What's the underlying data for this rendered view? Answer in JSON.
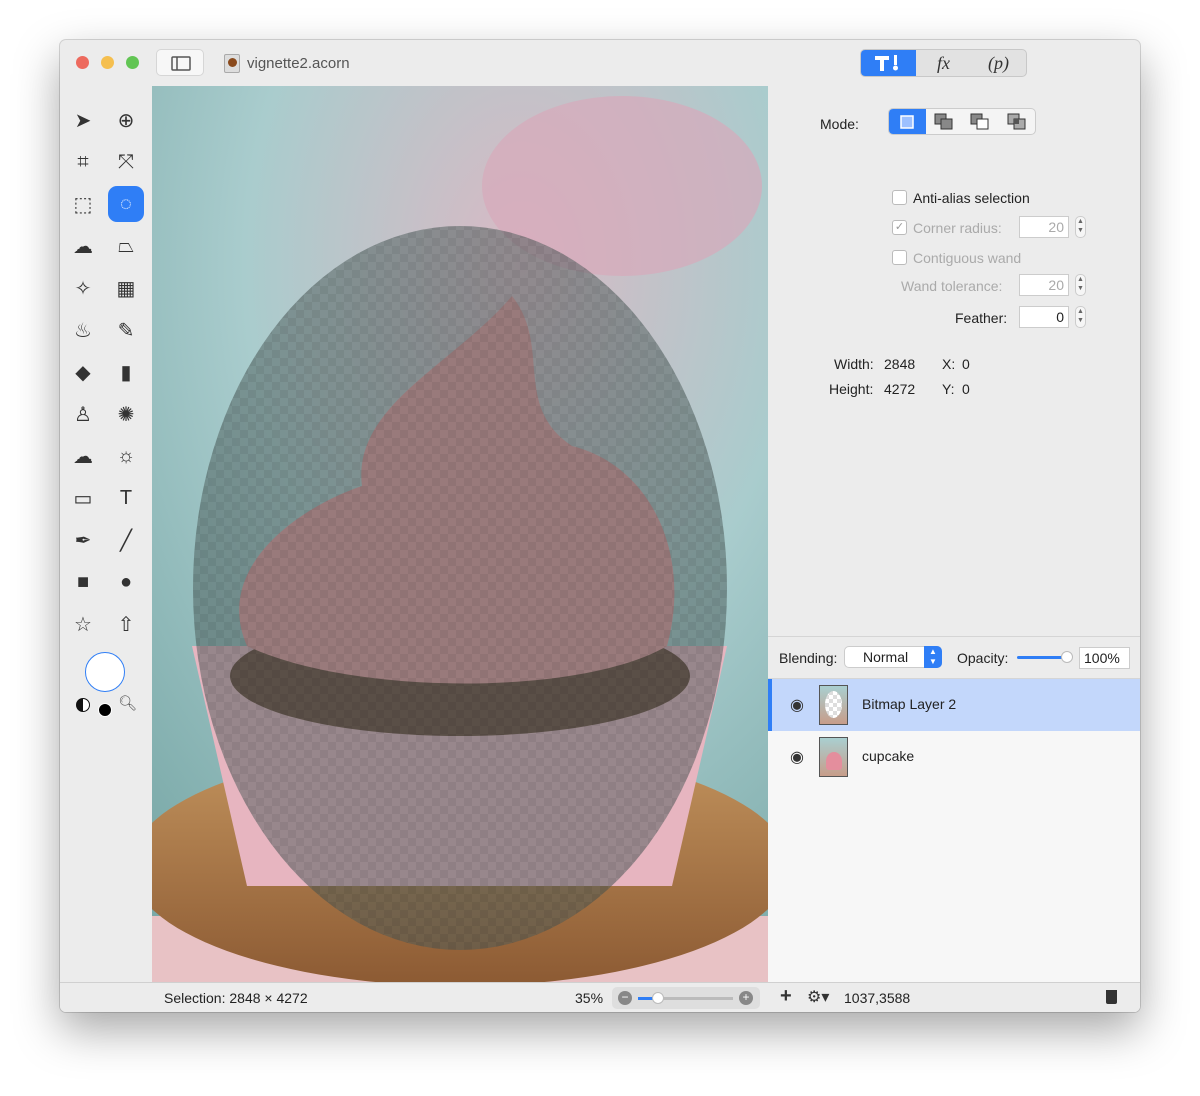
{
  "window": {
    "title": "vignette2.acorn",
    "colors": {
      "close": "#ed6a5e",
      "minimize": "#f5bf4f",
      "zoom": "#62c554",
      "accent": "#2f7ef6"
    }
  },
  "inspector_tabs": [
    {
      "label": "tools-icon",
      "active": true
    },
    {
      "label": "fx"
    },
    {
      "label": "(p)"
    }
  ],
  "tools": [
    "select-arrow",
    "zoom",
    "crop",
    "transform",
    "rect-marquee",
    "ellipse-marquee",
    "lasso",
    "polygon-lasso",
    "magic-wand",
    "color-wand",
    "brush",
    "pencil",
    "eraser",
    "smudge-bucket",
    "clone-stamp",
    "splatter",
    "burn-cloud",
    "dodge-sun",
    "gradient",
    "text",
    "pen",
    "line",
    "rectangle",
    "oval",
    "star",
    "arrow"
  ],
  "active_tool": "ellipse-marquee",
  "selection_options": {
    "mode_label": "Mode:",
    "modes": [
      "replace",
      "add",
      "subtract",
      "intersect"
    ],
    "active_mode": "replace",
    "anti_alias_label": "Anti-alias selection",
    "anti_alias": false,
    "corner_radius_label": "Corner radius:",
    "corner_radius": "20",
    "corner_radius_checked": true,
    "contiguous_label": "Contiguous wand",
    "contiguous": false,
    "wand_tolerance_label": "Wand tolerance:",
    "wand_tolerance": "20",
    "feather_label": "Feather:",
    "feather": "0",
    "width_label": "Width:",
    "width": "2848",
    "height_label": "Height:",
    "height": "4272",
    "x_label": "X:",
    "x": "0",
    "y_label": "Y:",
    "y": "0"
  },
  "layers_panel": {
    "blending_label": "Blending:",
    "blending": "Normal",
    "opacity_label": "Opacity:",
    "opacity": "100%",
    "opacity_value": 100,
    "layers": [
      {
        "name": "Bitmap Layer 2",
        "selected": true,
        "visible": true
      },
      {
        "name": "cupcake",
        "selected": false,
        "visible": true
      }
    ]
  },
  "status": {
    "selection": "Selection: 2848 × 4272",
    "zoom": "35%",
    "zoom_value": 35,
    "coords": "1037,3588"
  }
}
